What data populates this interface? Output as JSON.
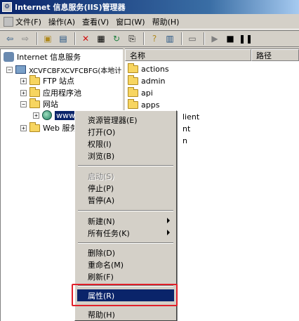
{
  "window": {
    "title": "Internet 信息服务(IIS)管理器"
  },
  "menubar": {
    "items": [
      {
        "label": "文件(F)"
      },
      {
        "label": "操作(A)"
      },
      {
        "label": "查看(V)"
      },
      {
        "label": "窗口(W)"
      },
      {
        "label": "帮助(H)"
      }
    ]
  },
  "toolbar": {
    "icons": [
      "back-icon",
      "forward-icon",
      "up-folder-icon",
      "show-tree-icon",
      "delete-icon",
      "properties-icon",
      "refresh-icon",
      "export-icon",
      "help-icon",
      "view-icon",
      "computer-icon",
      "play-icon",
      "stop-icon",
      "pause-icon"
    ]
  },
  "tree": {
    "root": "Internet 信息服务",
    "computer": "XCVFCBFXCVFCBFG(本地计",
    "ftp": "FTP 站点",
    "apppools": "应用程序池",
    "websites": "网站",
    "site": "www",
    "webext": "Web 服务"
  },
  "list": {
    "columns": [
      "名称",
      "路径"
    ],
    "rows": [
      {
        "name": "actions"
      },
      {
        "name": "admin"
      },
      {
        "name": "api"
      },
      {
        "name": "apps"
      }
    ],
    "partial": [
      "lient",
      "nt",
      "n"
    ]
  },
  "context_menu": {
    "items": [
      {
        "label": "资源管理器(E)"
      },
      {
        "label": "打开(O)"
      },
      {
        "label": "权限(I)"
      },
      {
        "label": "浏览(B)"
      },
      {
        "label": "启动(S)"
      },
      {
        "label": "停止(P)"
      },
      {
        "label": "暂停(A)"
      },
      {
        "label": "新建(N)"
      },
      {
        "label": "所有任务(K)"
      },
      {
        "label": "删除(D)"
      },
      {
        "label": "重命名(M)"
      },
      {
        "label": "刷新(F)"
      },
      {
        "label": "属性(R)"
      },
      {
        "label": "帮助(H)"
      }
    ]
  },
  "colors": {
    "selection": "#0a246a",
    "highlight_box": "#e0202a",
    "chrome": "#d4d0c8"
  }
}
